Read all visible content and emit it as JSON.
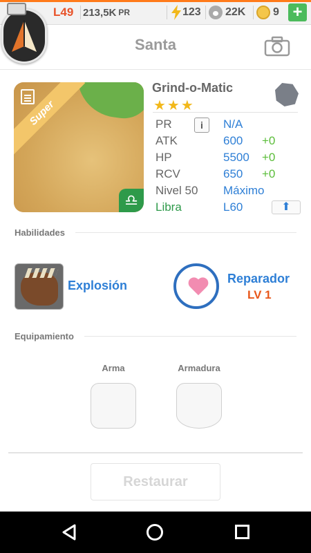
{
  "status": {
    "level": "L49",
    "pr_value": "213,5K",
    "pr_unit": "PR",
    "energy": "123",
    "paws": "22K",
    "coins": "9",
    "plus_label": "+"
  },
  "header": {
    "title": "Santa"
  },
  "card": {
    "rarity": "Super",
    "stars": "★★★",
    "zodiac_symbol": "♎"
  },
  "stats": {
    "name": "Grind-o-Matic",
    "rows": [
      {
        "label": "PR",
        "value": "N/A",
        "plus": ""
      },
      {
        "label": "ATK",
        "value": "600",
        "plus": "+0"
      },
      {
        "label": "HP",
        "value": "5500",
        "plus": "+0"
      },
      {
        "label": "RCV",
        "value": "650",
        "plus": "+0"
      },
      {
        "label": "Nivel 50",
        "value": "Máximo",
        "plus": ""
      },
      {
        "label": "Libra",
        "value": "L60",
        "plus": ""
      }
    ],
    "info_label": "i",
    "upgrade_icon": "⬆"
  },
  "abilities": {
    "title": "Habilidades",
    "skill1": "Explosión",
    "skill2": "Reparador",
    "skill2_level": "LV 1"
  },
  "equipment": {
    "title": "Equipamiento",
    "weapon_label": "Arma",
    "armor_label": "Armadura"
  },
  "actions": {
    "restore_label": "Restaurar"
  },
  "colors": {
    "accent_blue": "#2e7fd6",
    "level_orange": "#e8532a",
    "plus_green": "#5bbd3a",
    "libra_green": "#2e9a4a"
  }
}
